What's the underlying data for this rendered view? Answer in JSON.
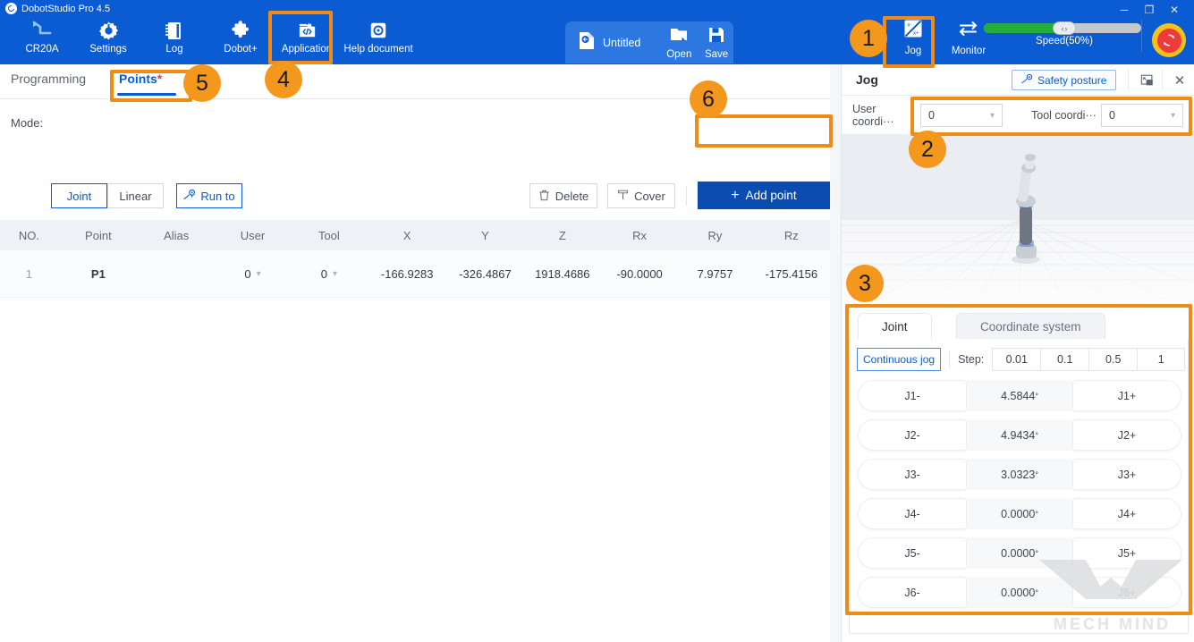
{
  "window": {
    "app_title": "DobotStudio Pro 4.5",
    "controls": {
      "minimize": "─",
      "maximize": "❐",
      "close": "✕"
    }
  },
  "toolbar": {
    "items": [
      {
        "label": "CR20A",
        "icon": "robot-arm-icon"
      },
      {
        "label": "Settings",
        "icon": "gear-icon"
      },
      {
        "label": "Log",
        "icon": "notebook-icon"
      },
      {
        "label": "Dobot+",
        "icon": "puzzle-icon"
      },
      {
        "label": "Application",
        "icon": "application-code-icon"
      },
      {
        "label": "Help document",
        "icon": "help-disc-icon"
      }
    ],
    "file_group": {
      "document_name": "Untitled",
      "open_label": "Open",
      "save_label": "Save"
    },
    "right_items": [
      {
        "label": "Jog",
        "icon": "jog-icon"
      },
      {
        "label": "Monitor",
        "icon": "monitor-arrows-icon"
      }
    ],
    "speed": {
      "label": "Speed(50%)",
      "percent": 50,
      "fill_color": "#27ad3c"
    },
    "estop_icon": "emergency-reset-icon"
  },
  "main": {
    "tabs": [
      {
        "label": "Programming",
        "active": false
      },
      {
        "label": "Points",
        "modified_mark": "*",
        "active": true
      }
    ],
    "mode": {
      "label": "Mode:",
      "options": [
        "Joint",
        "Linear"
      ],
      "selected": "Joint",
      "run_to_label": "Run to"
    },
    "actions": {
      "delete_label": "Delete",
      "cover_label": "Cover",
      "add_point_label": "Add point"
    },
    "table": {
      "columns": [
        "NO.",
        "Point",
        "Alias",
        "User",
        "Tool",
        "X",
        "Y",
        "Z",
        "Rx",
        "Ry",
        "Rz"
      ],
      "rows": [
        {
          "no": "1",
          "point": "P1",
          "alias": "",
          "user": "0",
          "tool": "0",
          "x": "-166.9283",
          "y": "-326.4867",
          "z": "1918.4686",
          "rx": "-90.0000",
          "ry": "7.9757",
          "rz": "-175.4156"
        }
      ]
    }
  },
  "jog_panel": {
    "title": "Jog",
    "safety_posture_label": "Safety posture",
    "popout_icon": "popout-window-icon",
    "close_icon": "close-icon",
    "user_coord": {
      "label": "User coordi···",
      "value": "0"
    },
    "tool_coord": {
      "label": "Tool coordi···",
      "value": "0"
    },
    "tabs": [
      {
        "label": "Joint",
        "active": true
      },
      {
        "label": "Coordinate system",
        "active": false
      }
    ],
    "continuous_jog_label": "Continuous jog",
    "step_label": "Step:",
    "step_values": [
      "0.01",
      "0.1",
      "0.5",
      "1"
    ],
    "joints": [
      {
        "minus": "J1-",
        "value": "4.5844",
        "unit": "°",
        "plus": "J1+"
      },
      {
        "minus": "J2-",
        "value": "4.9434",
        "unit": "°",
        "plus": "J2+"
      },
      {
        "minus": "J3-",
        "value": "3.0323",
        "unit": "°",
        "plus": "J3+"
      },
      {
        "minus": "J4-",
        "value": "0.0000",
        "unit": "°",
        "plus": "J4+"
      },
      {
        "minus": "J5-",
        "value": "0.0000",
        "unit": "°",
        "plus": "J5+"
      },
      {
        "minus": "J6-",
        "value": "0.0000",
        "unit": "°",
        "plus": "J6+"
      }
    ]
  },
  "watermark": {
    "text": "MECH MIND"
  },
  "annotations": {
    "color": "#f4971d",
    "badges": [
      "1",
      "2",
      "3",
      "4",
      "5",
      "6"
    ]
  }
}
